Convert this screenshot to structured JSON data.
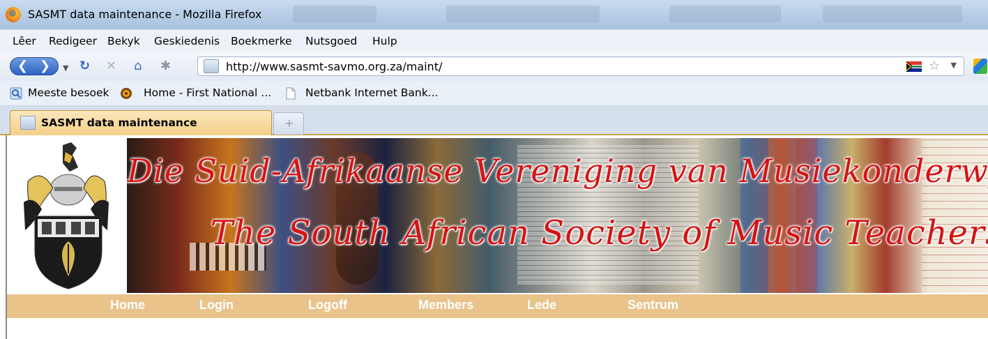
{
  "window": {
    "title": "SASMT data maintenance - Mozilla Firefox"
  },
  "menu": {
    "items": [
      {
        "label": "Lêer"
      },
      {
        "label": "Redigeer"
      },
      {
        "label": "Bekyk"
      },
      {
        "label": "Geskiedenis"
      },
      {
        "label": "Boekmerke"
      },
      {
        "label": "Nutsgoed"
      },
      {
        "label": "Hulp"
      }
    ]
  },
  "address": {
    "url": "http://www.sasmt-savmo.org.za/maint/"
  },
  "bookmarks": {
    "items": [
      {
        "label": "Meeste besoek"
      },
      {
        "label": "Home - First National ..."
      },
      {
        "label": "Netbank Internet Bank..."
      }
    ]
  },
  "tabs": {
    "active_label": "SASMT data maintenance"
  },
  "page": {
    "banner_line1": "Die Suid-Afrikaanse Vereniging van Musiekonderwyse",
    "banner_line2": "The South African Society of Music Teachers",
    "nav": [
      {
        "label": "Home"
      },
      {
        "label": "Login"
      },
      {
        "label": "Logoff"
      },
      {
        "label": "Members"
      },
      {
        "label": "Lede"
      },
      {
        "label": "Sentrum"
      }
    ]
  },
  "colors": {
    "nav_strip": "#e9c38a",
    "banner_text": "#d51414",
    "active_tab": "#f3cf87"
  }
}
